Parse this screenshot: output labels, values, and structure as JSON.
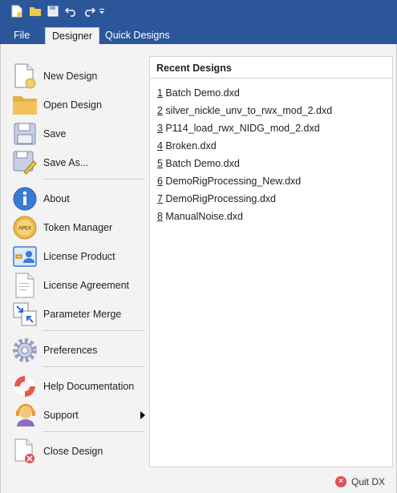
{
  "quick_access": {
    "icons": [
      "new-file-icon",
      "open-folder-icon",
      "save-icon",
      "undo-icon",
      "redo-icon",
      "customize-dropdown-icon"
    ]
  },
  "tabs": {
    "file": "File",
    "designer": "Designer",
    "quick_designs": "Quick Designs"
  },
  "menu": {
    "new_design": "New Design",
    "open_design": "Open Design",
    "save": "Save",
    "save_as": "Save As...",
    "about": "About",
    "token_manager": "Token Manager",
    "license_product": "License Product",
    "license_agreement": "License Agreement",
    "parameter_merge": "Parameter Merge",
    "preferences": "Preferences",
    "help_documentation": "Help Documentation",
    "support": "Support",
    "close_design": "Close Design",
    "apex_badge": "APEX"
  },
  "recent": {
    "title": "Recent Designs",
    "items": [
      {
        "num": "1",
        "name": " Batch Demo.dxd"
      },
      {
        "num": "2",
        "name": " silver_nickle_unv_to_rwx_mod_2.dxd"
      },
      {
        "num": "3",
        "name": " P114_load_rwx_NIDG_mod_2.dxd"
      },
      {
        "num": "4",
        "name": " Broken.dxd"
      },
      {
        "num": "5",
        "name": " Batch Demo.dxd"
      },
      {
        "num": "6",
        "name": " DemoRigProcessing_New.dxd"
      },
      {
        "num": "7",
        "name": " DemoRigProcessing.dxd"
      },
      {
        "num": "8",
        "name": " ManualNoise.dxd"
      }
    ]
  },
  "quit_label": "Quit DX",
  "colors": {
    "ribbon": "#2b579a",
    "panel": "#f3f3f3",
    "quit_icon": "#e05050"
  }
}
